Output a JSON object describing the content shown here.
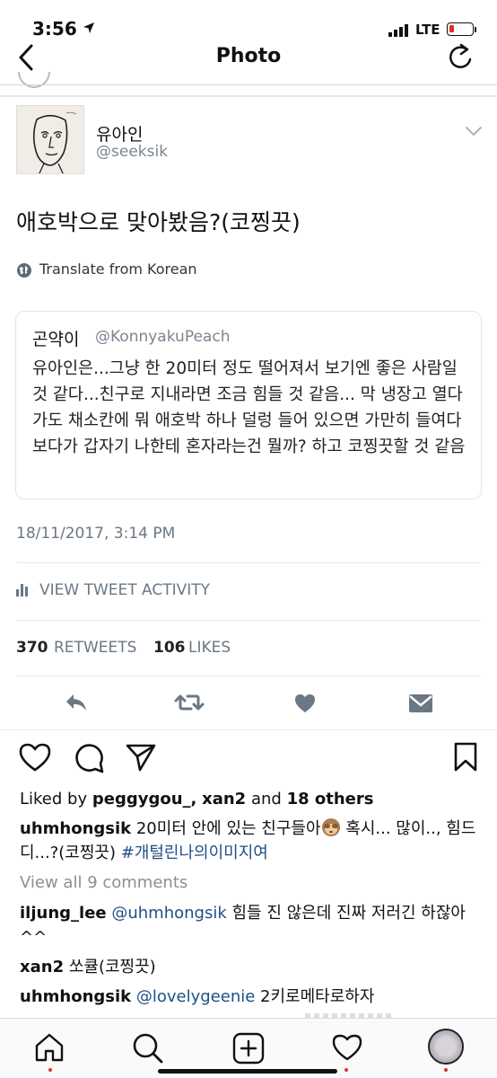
{
  "status_bar": {
    "time": "3:56",
    "network": "LTE"
  },
  "nav": {
    "title": "Photo"
  },
  "tweet": {
    "author_name": "유아인",
    "author_handle": "@seeksik",
    "text": "애호박으로 맞아봤음?(코찡끗)",
    "translate": "Translate from Korean",
    "quote": {
      "author_name": "곤약이",
      "author_handle": "@KonnyakuPeach",
      "text": "유아인은...그냥 한 20미터 정도 떨어져서 보기엔 좋은 사람일 것 같다...친구로 지내라면 조금 힘들 것 같음... 막 냉장고 열다가도 채소칸에 뭐 애호박 하나 덜렁 들어 있으면 가만히 들여다보다가 갑자기 나한테 혼자라는건 뭘까? 하고 코찡끗할 것 같음"
    },
    "timestamp": "18/11/2017, 3:14 PM",
    "activity_label": "VIEW TWEET ACTIVITY",
    "retweets_count": "370",
    "retweets_label": "RETWEETS",
    "likes_count": "106",
    "likes_label": "LIKES",
    "actions": [
      "reply-icon",
      "retweet-icon",
      "like-icon",
      "dm-icon"
    ]
  },
  "post": {
    "liked_by_prefix": "Liked by",
    "liked_by_user1": "peggygou_",
    "liked_by_sep": ",",
    "liked_by_user2": "xan2",
    "liked_by_and": "and",
    "liked_by_others": "18 others",
    "caption_user": "uhmhongsik",
    "caption_text_1": "20미터 안에 있는 친구들아",
    "caption_emoji": "see-no-evil-monkey-emoji",
    "caption_text_2": " 혹시... 많이.., 힘드디...?(코찡끗) ",
    "caption_hashtag": "#개털린나의이미지여",
    "view_all_comments": "View all 9 comments",
    "comments": [
      {
        "user": "iljung_lee",
        "mention": "@uhmhongsik",
        "text": " 힘들 진 않은데 진짜 저러긴 하잖아^^"
      },
      {
        "user": "xan2",
        "mention": "",
        "text": "쏘큘(코찡끗)"
      },
      {
        "user": "uhmhongsik",
        "mention": "@lovelygeenie",
        "text": " 2키로메타로하자"
      }
    ]
  },
  "tab_bar": {
    "items": [
      "home-icon",
      "search-icon",
      "add-post-icon",
      "activity-heart-icon",
      "profile-avatar"
    ]
  },
  "colors": {
    "link": "#1f4f86",
    "secondary": "#7a8691",
    "notification_dot": "#e0302a"
  }
}
